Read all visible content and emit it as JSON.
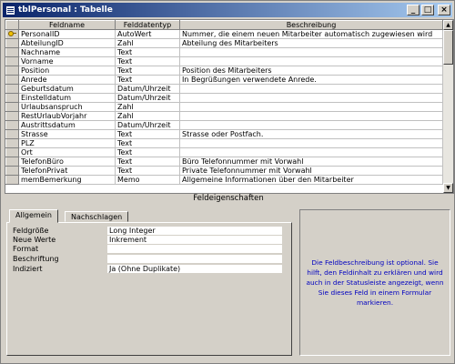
{
  "window": {
    "title": "tblPersonal : Tabelle",
    "min_label": "_",
    "max_label": "□",
    "close_label": "×"
  },
  "grid": {
    "columns": [
      "Feldname",
      "Felddatentyp",
      "Beschreibung"
    ],
    "rows": [
      {
        "name": "PersonalID",
        "type": "AutoWert",
        "desc": "Nummer, die einem neuen Mitarbeiter automatisch zugewiesen wird",
        "key": true
      },
      {
        "name": "AbteilungID",
        "type": "Zahl",
        "desc": "Abteilung des Mitarbeiters"
      },
      {
        "name": "Nachname",
        "type": "Text",
        "desc": ""
      },
      {
        "name": "Vorname",
        "type": "Text",
        "desc": ""
      },
      {
        "name": "Position",
        "type": "Text",
        "desc": "Position des Mitarbeiters"
      },
      {
        "name": "Anrede",
        "type": "Text",
        "desc": "In Begrüßungen verwendete Anrede."
      },
      {
        "name": "Geburtsdatum",
        "type": "Datum/Uhrzeit",
        "desc": ""
      },
      {
        "name": "Einstelldatum",
        "type": "Datum/Uhrzeit",
        "desc": ""
      },
      {
        "name": "Urlaubsanspruch",
        "type": "Zahl",
        "desc": ""
      },
      {
        "name": "RestUrlaubVorjahr",
        "type": "Zahl",
        "desc": ""
      },
      {
        "name": "Austrittsdatum",
        "type": "Datum/Uhrzeit",
        "desc": ""
      },
      {
        "name": "Strasse",
        "type": "Text",
        "desc": "Strasse oder Postfach."
      },
      {
        "name": "PLZ",
        "type": "Text",
        "desc": ""
      },
      {
        "name": "Ort",
        "type": "Text",
        "desc": ""
      },
      {
        "name": "TelefonBüro",
        "type": "Text",
        "desc": "Büro Telefonnummer mit Vorwahl"
      },
      {
        "name": "TelefonPrivat",
        "type": "Text",
        "desc": "Private Telefonnummer mit Vorwahl"
      },
      {
        "name": "memBemerkung",
        "type": "Memo",
        "desc": "Allgemeine Informationen über den Mitarbeiter"
      }
    ]
  },
  "properties": {
    "header": "Feldeigenschaften",
    "tabs": [
      "Allgemein",
      "Nachschlagen"
    ],
    "items": [
      {
        "label": "Feldgröße",
        "value": "Long Integer"
      },
      {
        "label": "Neue Werte",
        "value": "Inkrement"
      },
      {
        "label": "Format",
        "value": ""
      },
      {
        "label": "Beschriftung",
        "value": ""
      },
      {
        "label": "Indiziert",
        "value": "Ja (Ohne Duplikate)"
      }
    ],
    "help": "Die Feldbeschreibung ist optional. Sie hilft, den Feldinhalt zu erklären und wird auch in der Statusleiste angezeigt, wenn Sie dieses Feld in einem Formular markieren."
  },
  "icons": {
    "app": "table-icon",
    "key": "primary-key-icon",
    "current_row": "current-row-arrow-icon"
  }
}
